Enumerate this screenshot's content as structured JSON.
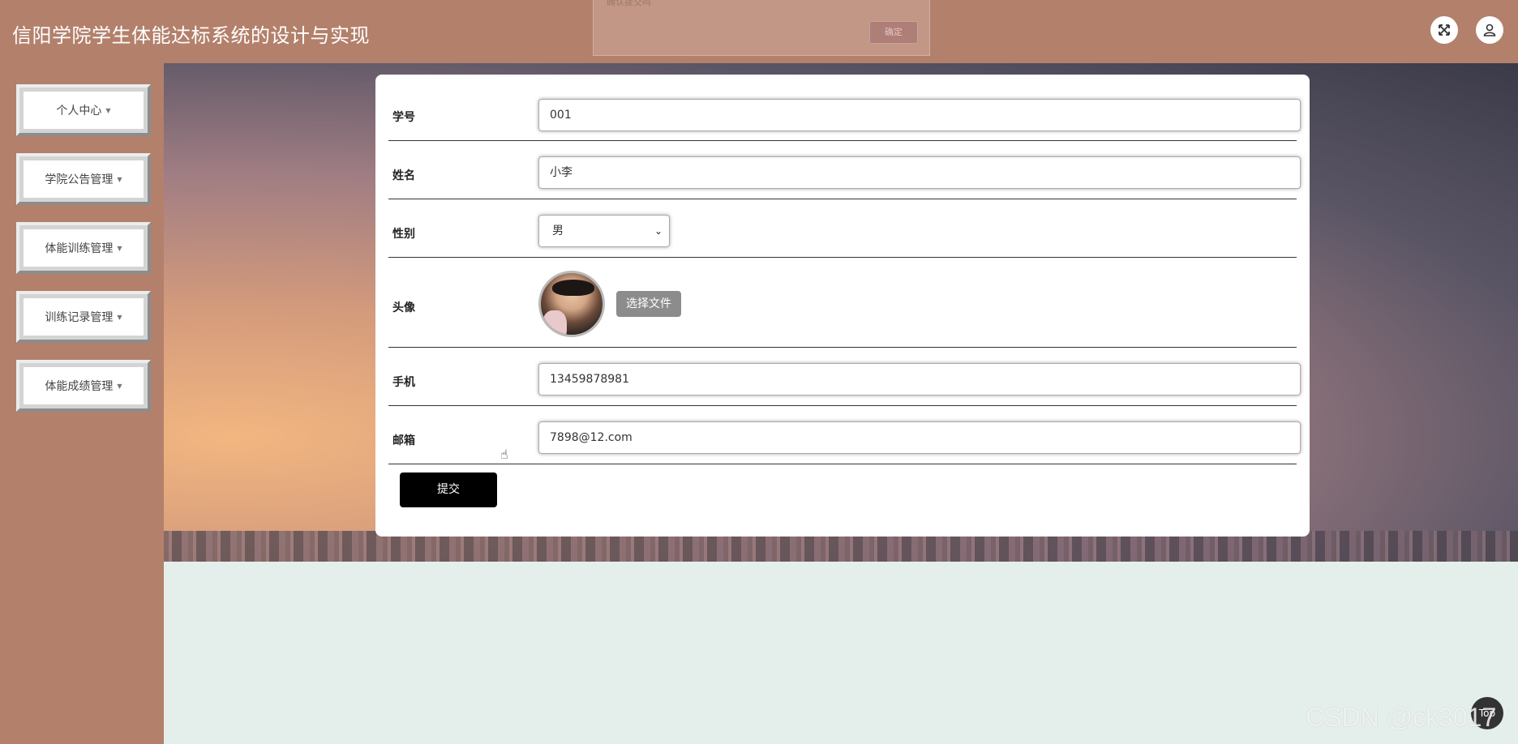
{
  "header": {
    "title": "信阳学院学生体能达标系统的设计与实现",
    "ghost_dialog": {
      "text": "确认提交吗",
      "confirm_label": "确定"
    },
    "fullscreen_icon": "fullscreen-icon",
    "user_icon": "user-icon"
  },
  "sidebar": {
    "items": [
      {
        "label": "个人中心"
      },
      {
        "label": "学院公告管理"
      },
      {
        "label": "体能训练管理"
      },
      {
        "label": "训练记录管理"
      },
      {
        "label": "体能成绩管理"
      }
    ]
  },
  "form": {
    "student_id": {
      "label": "学号",
      "value": "001"
    },
    "name": {
      "label": "姓名",
      "value": "小李"
    },
    "gender": {
      "label": "性别",
      "value": "男"
    },
    "avatar": {
      "label": "头像",
      "button_label": "选择文件"
    },
    "phone": {
      "label": "手机",
      "value": "13459878981"
    },
    "email": {
      "label": "邮箱",
      "value": "7898@12.com"
    },
    "submit_label": "提交"
  },
  "footer": {
    "top_label": "Top",
    "watermark": "CSDN @ck3017"
  }
}
